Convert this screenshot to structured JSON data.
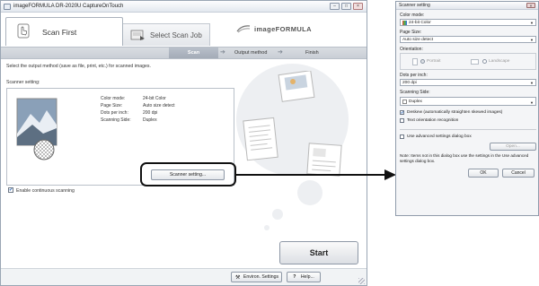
{
  "window": {
    "title": "imageFORMULA DR-2020U CaptureOnTouch",
    "controls": {
      "minimize": "–",
      "maximize": "□",
      "close": "×"
    }
  },
  "header": {
    "tabs": [
      {
        "label": "Scan First",
        "active": true
      },
      {
        "label": "Select Scan Job",
        "active": false
      }
    ],
    "logo": "imageFORMULA"
  },
  "steps": [
    {
      "label": "Scan",
      "active": true
    },
    {
      "label": "Output method",
      "active": false
    },
    {
      "label": "Finish",
      "active": false
    }
  ],
  "main": {
    "instruction": "Select the output method (save as file, print, etc.) for scanned images.",
    "group_label": "Scanner setting:",
    "settings": [
      {
        "key": "Color mode:",
        "value": "24-bit Color"
      },
      {
        "key": "Page Size:",
        "value": "Auto size detect"
      },
      {
        "key": "Dots per inch:",
        "value": "200 dpi"
      },
      {
        "key": "Scanning Side:",
        "value": "Duplex"
      }
    ],
    "scanner_setting_button": "Scanner setting...",
    "continuous_label": "Enable continuous scanning",
    "continuous_checked": true,
    "start_button": "Start"
  },
  "footer": {
    "env_settings": "Environ. Settings",
    "help_icon_text": "?",
    "help": "Help..."
  },
  "dialog": {
    "title": "Scanner setting",
    "color_mode_label": "Color mode:",
    "color_mode_value": "24-bit Color",
    "page_size_label": "Page Size:",
    "page_size_value": "Auto size detect",
    "orientation_label": "Orientation:",
    "portrait": "Portrait",
    "landscape": "Landscape",
    "dpi_label": "Dots per inch:",
    "dpi_value": "200 dpi",
    "side_label": "Scanning Side:",
    "side_value": "Duplex",
    "deskew_label": "Deskew (automatically straighten skewed images)",
    "deskew_checked": true,
    "text_orient_label": "Text orientation recognition",
    "text_orient_checked": false,
    "advanced_label": "Use advanced settings dialog box",
    "advanced_checked": false,
    "open_button": "Open...",
    "note": "Note: Items not in this dialog box use the settings in the Use advanced settings dialog box.",
    "ok": "OK",
    "cancel": "Cancel",
    "close": "×"
  },
  "colors": {
    "accent_step": "#a7afba",
    "border": "#9aa6b4",
    "arrow": "#111111"
  }
}
